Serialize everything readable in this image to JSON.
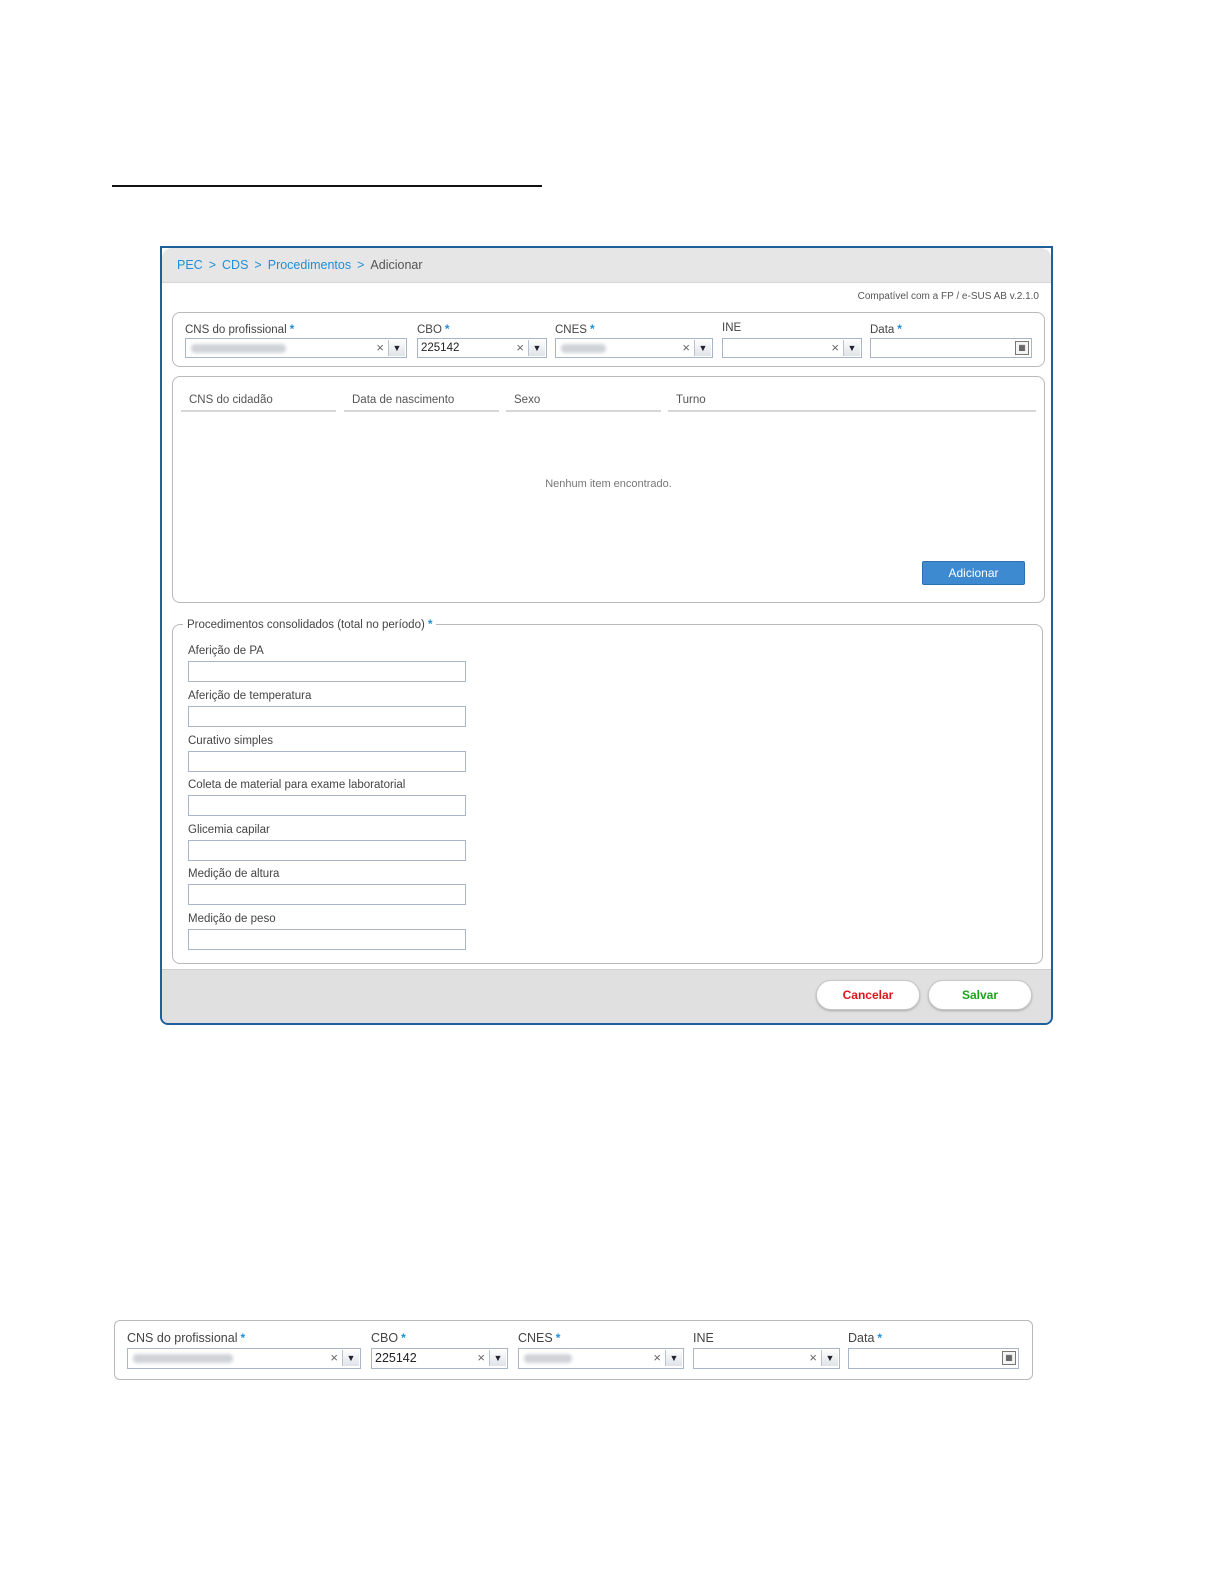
{
  "breadcrumb": {
    "items": [
      "PEC",
      "CDS",
      "Procedimentos"
    ],
    "current": "Adicionar",
    "separator": ">"
  },
  "compat_note": "Compatível com a FP / e-SUS AB v.2.1.0",
  "header_fields": {
    "cns": {
      "label": "CNS do profissional",
      "required": "*"
    },
    "cbo": {
      "label": "CBO",
      "value": "225142",
      "required": "*"
    },
    "cnes": {
      "label": "CNES",
      "required": "*"
    },
    "ine": {
      "label": "INE"
    },
    "data": {
      "label": "Data",
      "required": "*"
    }
  },
  "table": {
    "columns": [
      "CNS do cidadão",
      "Data de nascimento",
      "Sexo",
      "Turno"
    ],
    "empty_message": "Nenhum item encontrado.",
    "add_button": "Adicionar"
  },
  "procedures": {
    "legend": "Procedimentos consolidados (total no período)",
    "required": "*",
    "items": [
      {
        "label": "Aferição de PA"
      },
      {
        "label": "Aferição de temperatura"
      },
      {
        "label": "Curativo simples"
      },
      {
        "label": "Coleta de material para exame laboratorial"
      },
      {
        "label": "Glicemia capilar"
      },
      {
        "label": "Medição de altura"
      },
      {
        "label": "Medição de peso"
      }
    ]
  },
  "footer": {
    "cancel": "Cancelar",
    "save": "Salvar"
  },
  "icons": {
    "clear": "×",
    "dropdown": "▼",
    "calendar": "calendar-icon"
  },
  "colors": {
    "accent": "#1f8fd8",
    "frame": "#1f5f9a",
    "add_button": "#3d8ad0",
    "cancel_text": "#e0151b",
    "save_text": "#1ea21e"
  }
}
